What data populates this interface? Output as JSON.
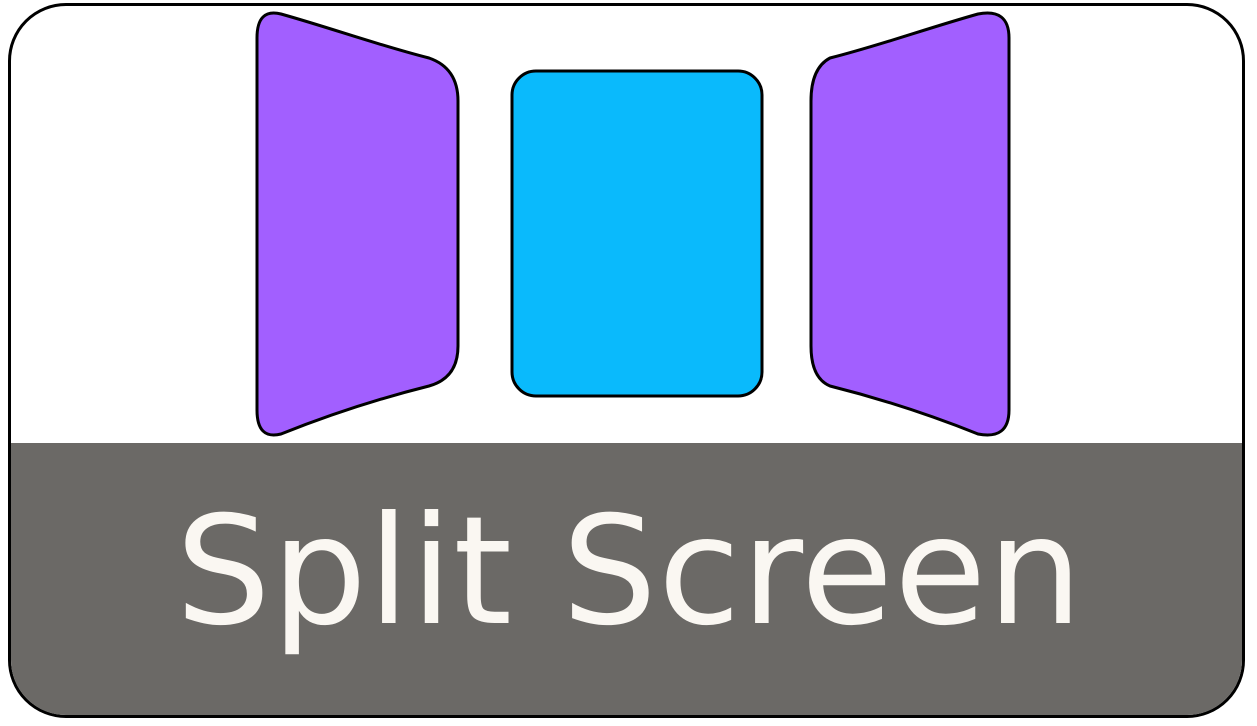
{
  "icon": {
    "name": "split-screen-icon",
    "label": "Split Screen"
  },
  "colors": {
    "side_panel": "#A25FFF",
    "center_panel": "#0ABAFC",
    "outline": "#000000",
    "label_bar": "#6B6966",
    "label_text": "#FAF7F2",
    "background": "#FFFFFF"
  }
}
